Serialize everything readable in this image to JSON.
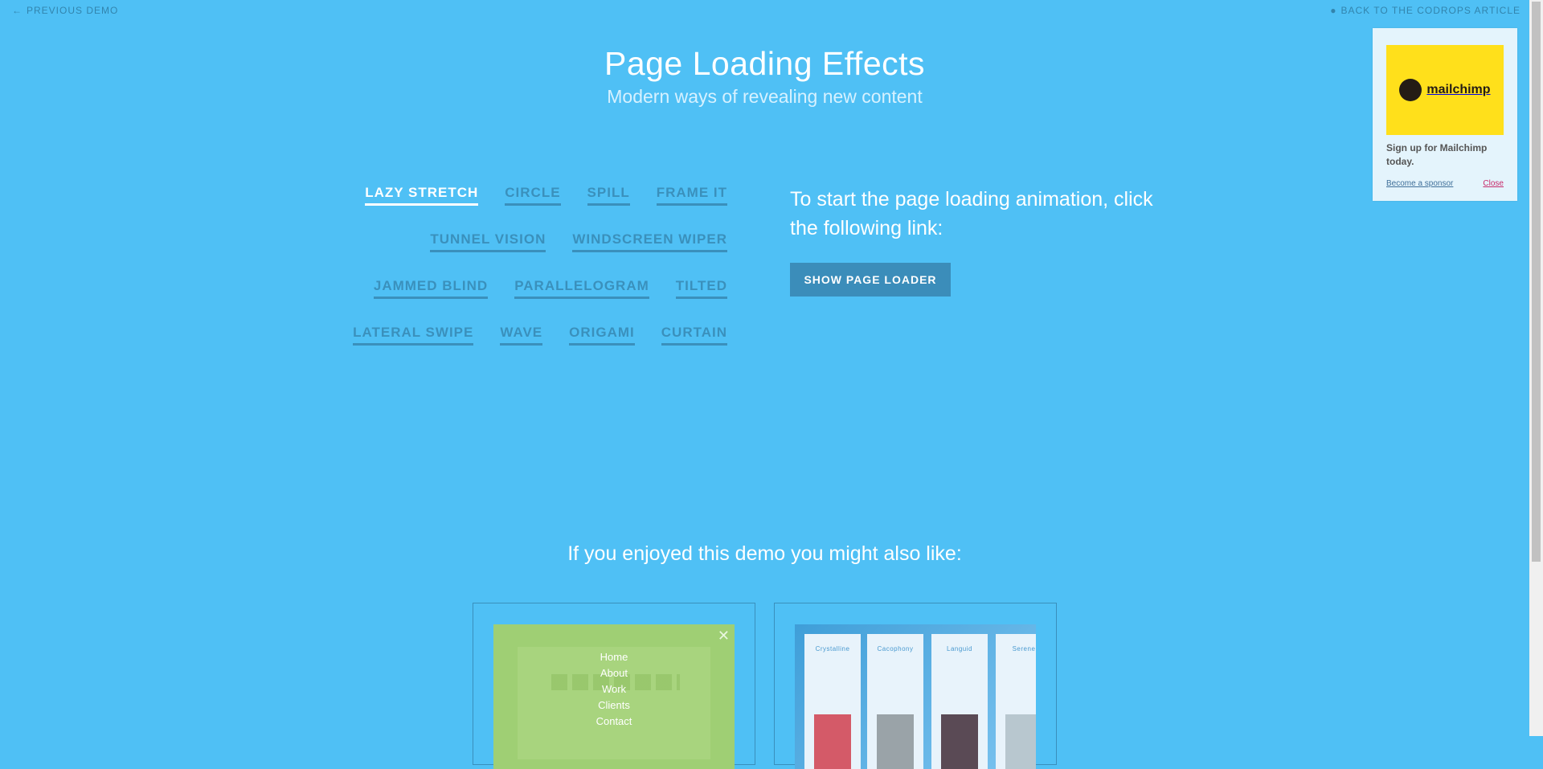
{
  "topnav": {
    "prev_icon": "arrow-left-icon",
    "prev_label": "Previous Demo",
    "back_icon": "drop-icon",
    "back_label": "Back to the Codrops Article"
  },
  "header": {
    "title": "Page Loading Effects",
    "subtitle": "Modern ways of revealing new content"
  },
  "effects": [
    [
      "Lazy Stretch",
      "Circle",
      "Spill",
      "Frame it"
    ],
    [
      "Tunnel Vision",
      "Windscreen Wiper"
    ],
    [
      "Jammed Blind",
      "Parallelogram",
      "Tilted"
    ],
    [
      "Lateral Swipe",
      "Wave",
      "Origami",
      "Curtain"
    ]
  ],
  "active_effect": "Lazy Stretch",
  "intro": "To start the page loading animation, click the following link:",
  "button_label": "Show Page Loader",
  "related": {
    "title": "If you enjoyed this demo you might also like:",
    "card1": {
      "menu": [
        "Home",
        "About",
        "Work",
        "Clients",
        "Contact"
      ]
    },
    "card2": {
      "panels": [
        "Crystalline",
        "Cacophony",
        "Languid",
        "Serene"
      ]
    }
  },
  "sponsor": {
    "brand": "mailchimp",
    "text": "Sign up for Mailchimp today.",
    "become": "Become a sponsor",
    "close": "Close"
  },
  "colors": {
    "background": "#4fc0f5",
    "link": "#3a90bc",
    "button": "#3b8dba",
    "sponsor_logo": "#ffe01b",
    "close_link": "#c72a6a"
  }
}
